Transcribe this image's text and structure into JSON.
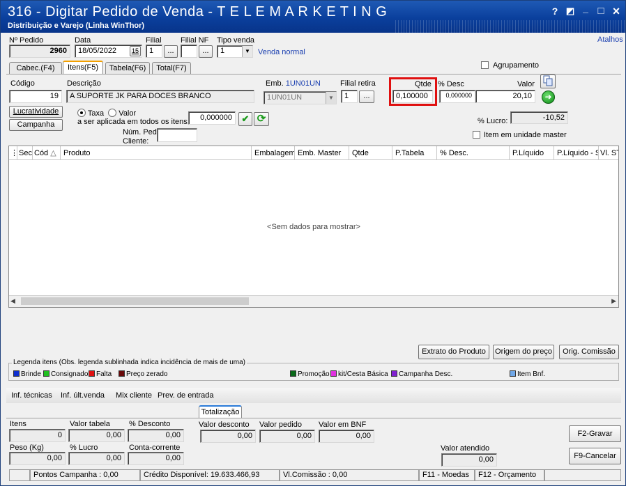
{
  "window": {
    "title": "316 - Digitar Pedido de Venda - T E L E M A R K E T I N G",
    "subtitle": "Distribuição e Varejo (Linha WinThor)",
    "help_glyph": "?",
    "minimize_glyph": "_",
    "close_glyph": "×",
    "restore_glyph": "◩",
    "maximize_glyph": "□"
  },
  "header": {
    "pedido_label": "Nº Pedido",
    "pedido_value": "2960",
    "data_label": "Data",
    "data_value": "18/05/2022",
    "calendar_glyph": "15",
    "filial_label": "Filial",
    "filial_value": "1",
    "filialnf_label": "Filial NF",
    "filialnf_value": "",
    "tipovenda_label": "Tipo venda",
    "tipovenda_value": "1",
    "tipovenda_desc": "Venda normal",
    "lookup_glyph": "...",
    "atalhos": "Atalhos",
    "agrupamento_label": "Agrupamento"
  },
  "tabs": [
    {
      "label": "Cabec.(F4)"
    },
    {
      "label": "Itens(F5)"
    },
    {
      "label": "Tabela(F6)"
    },
    {
      "label": "Total(F7)"
    }
  ],
  "item": {
    "codigo_label": "Código",
    "codigo_value": "19",
    "descricao_label": "Descrição",
    "descricao_value": "A SUPORTE JK PARA DOCES BRANCO",
    "emb_label": "Emb.",
    "emb_code": "1UN01UN",
    "emb_value": "1UN01UN",
    "filialretira_label": "Filial retira",
    "filialretira_value": "1",
    "qtde_label": "Qtde",
    "qtde_value": "0,100000",
    "desc_label": "% Desc",
    "desc_value": "0,000000",
    "valor_label": "Valor",
    "valor_value": "20,10",
    "lucratividade_button": "Lucratividade",
    "campanha_button": "Campanha",
    "taxa_label": "Taxa",
    "valor_radio_label": "Valor",
    "aplicada_label": "a ser aplicada em todos os itens:",
    "aplicada_value": "0,000000",
    "numped_label": "Núm. Ped.",
    "cliente_label": "Cliente:",
    "numped_value": "",
    "lucro_label": "% Lucro:",
    "lucro_value": "-10,52",
    "unidade_master_label": "Item em unidade master",
    "confirm_glyph": "✔",
    "refresh_glyph": "⟳",
    "go_glyph": "➜"
  },
  "grid": {
    "columns": [
      "Sec",
      "Cód",
      "Produto",
      "Embalagem",
      "Emb. Master",
      "Qtde",
      "P.Tabela",
      "% Desc.",
      "P.Líquido",
      "P.Líquido - S",
      "Vl. ST"
    ],
    "empty_text": "<Sem dados para mostrar>",
    "sort_glyph": "△"
  },
  "buttons": {
    "extrato": "Extrato do Produto",
    "origem": "Origem do preço",
    "comissao": "Orig. Comissão",
    "gravar": "F2-Gravar",
    "cancelar": "F9-Cancelar"
  },
  "legend": {
    "title": "Legenda itens (Obs. legenda sublinhada indica incidência de mais de uma)",
    "items": [
      {
        "label": "Brinde",
        "color": "#1030d0"
      },
      {
        "label": "Consignado",
        "color": "#20c020"
      },
      {
        "label": "Falta",
        "color": "#e01010"
      },
      {
        "label": "Preço zerado",
        "color": "#6a0a0a"
      },
      {
        "label": "Promoção",
        "color": "#0a6a1a"
      },
      {
        "label": "kit/Cesta Básica",
        "color": "#e030e0"
      },
      {
        "label": "Campanha Desc.",
        "color": "#8020d0"
      },
      {
        "label": "Item Bnf.",
        "color": "#70a8e8"
      }
    ]
  },
  "links": [
    "Inf. técnicas",
    "Inf. últ.venda",
    "Mix cliente",
    "Prev. de entrada"
  ],
  "totalizacao": {
    "tab": "Totalização",
    "itens_label": "Itens",
    "itens_value": "0",
    "valortabela_label": "Valor tabela",
    "valortabela_value": "0,00",
    "pdesconto_label": "% Desconto",
    "pdesconto_value": "0,00",
    "valordesconto_label": "Valor desconto",
    "valordesconto_value": "0,00",
    "valorpedido_label": "Valor pedido",
    "valorpedido_value": "0,00",
    "valorbnf_label": "Valor em BNF",
    "valorbnf_value": "0,00",
    "peso_label": "Peso (Kg)",
    "peso_value": "0,00",
    "plucro_label": "% Lucro",
    "plucro_value": "0,00",
    "conta_label": "Conta-corrente",
    "conta_value": "0,00",
    "atendido_label": "Valor atendido",
    "atendido_value": "0,00"
  },
  "status": {
    "pontos": "Pontos Campanha : 0,00",
    "credito": "Crédito Disponível: 19.633.466,93",
    "comissao": "Vl.Comissão : 0,00",
    "moedas": "F11 - Moedas",
    "orcamento": "F12 - Orçamento"
  },
  "colors": {
    "title_bar": "#0a3f9c",
    "highlight": "#e01010",
    "accent": "#f3a000"
  }
}
